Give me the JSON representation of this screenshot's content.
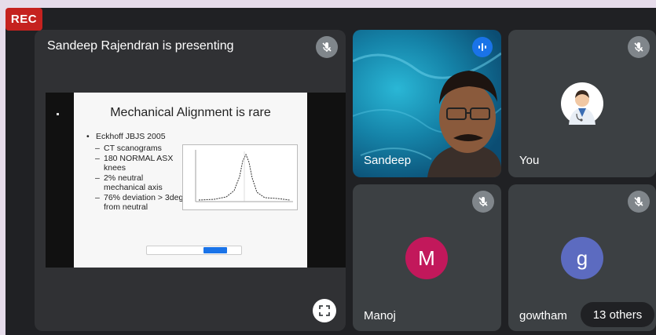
{
  "recording_badge": "REC",
  "presentation": {
    "title": "Sandeep Rajendran is presenting",
    "slide": {
      "title": "Mechanical Alignment is rare",
      "bullet": "Eckhoff JBJS 2005",
      "sub_bullets": [
        "CT scanograms",
        "180 NORMAL ASX  knees",
        "2% neutral mechanical axis",
        "76% deviation > 3deg from neutral"
      ]
    }
  },
  "participants": [
    {
      "name": "Sandeep",
      "speaking": true
    },
    {
      "name": "You",
      "muted": true
    },
    {
      "name": "Manoj",
      "initial": "M",
      "muted": true,
      "color": "#c2185b"
    },
    {
      "name": "gowtham",
      "initial": "g",
      "muted": true,
      "color": "#5c6bc0"
    }
  ],
  "others_label": "13 others",
  "colors": {
    "tile_bg": "#3c4043",
    "stage_bg": "#202124",
    "rec": "#c5221f",
    "speaking": "#1a73e8"
  }
}
